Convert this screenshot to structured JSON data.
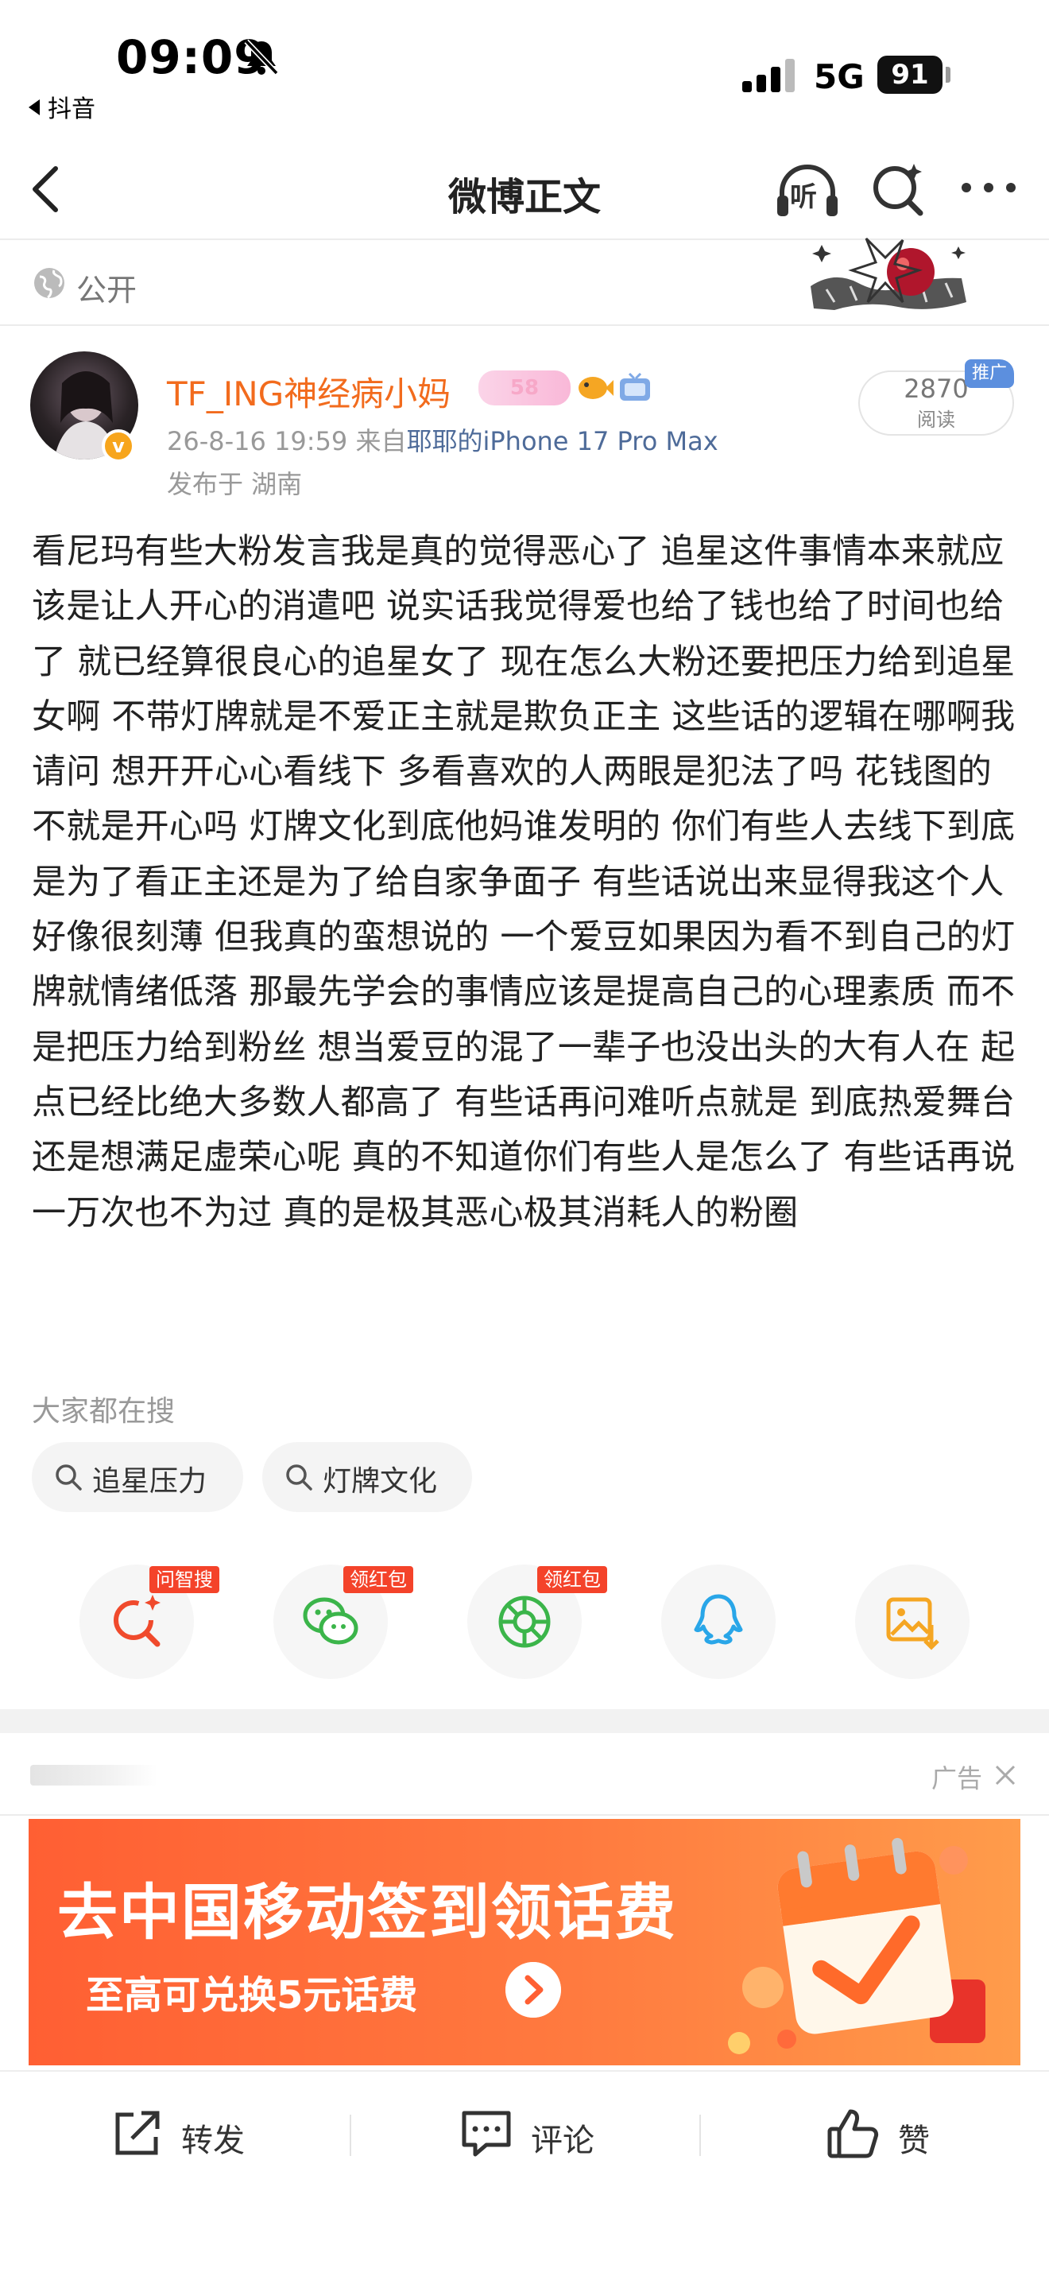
{
  "status_bar": {
    "time": "09:09",
    "back_app": "抖音",
    "network": "5G",
    "battery": "91"
  },
  "nav": {
    "title": "微博正文",
    "listen_label": "听"
  },
  "visibility": {
    "label": "公开"
  },
  "author": {
    "name": "TF_ING神经病小妈",
    "level": "58",
    "verified_mark": "v",
    "time": "26-8-16 19:59",
    "source_prefix": "来自",
    "source": "耶耶的iPhone 17 Pro Max",
    "location": "发布于 湖南"
  },
  "reads": {
    "count": "2870",
    "label": "阅读",
    "promo_tag": "推广"
  },
  "post": {
    "text": "看尼玛有些大粉发言我是真的觉得恶心了 追星这件事情本来就应该是让人开心的消遣吧 说实话我觉得爱也给了钱也给了时间也给了 就已经算很良心的追星女了 现在怎么大粉还要把压力给到追星女啊 不带灯牌就是不爱正主就是欺负正主 这些话的逻辑在哪啊我请问 想开开心心看线下 多看喜欢的人两眼是犯法了吗 花钱图的不就是开心吗 灯牌文化到底他妈谁发明的 你们有些人去线下到底是为了看正主还是为了给自家争面子 有些话说出来显得我这个人好像很刻薄 但我真的蛮想说的 一个爱豆如果因为看不到自己的灯牌就情绪低落 那最先学会的事情应该是提高自己的心理素质 而不是把压力给到粉丝 想当爱豆的混了一辈子也没出头的大有人在 起点已经比绝大多数人都高了 有些话再问难听点就是 到底热爱舞台还是想满足虚荣心呢 真的不知道你们有些人是怎么了 有些话再说一万次也不为过 真的是极其恶心极其消耗人的粉圈"
  },
  "search": {
    "title": "大家都在搜",
    "chips": [
      {
        "label": "追星压力"
      },
      {
        "label": "灯牌文化"
      }
    ]
  },
  "share": {
    "tags": [
      "问智搜",
      "领红包",
      "领红包"
    ],
    "icons": [
      "ai-search-icon",
      "wechat-icon",
      "moments-icon",
      "qq-icon",
      "save-image-icon"
    ]
  },
  "ad": {
    "label": "广告",
    "headline": "去中国移动签到领话费",
    "subline": "至高可兑换5元话费"
  },
  "bottom_bar": {
    "repost": "转发",
    "comment": "评论",
    "like": "赞"
  },
  "colors": {
    "accent_orange": "#f26b1d",
    "link_blue": "#4e6b99",
    "tag_red": "#f4432a",
    "promo_blue": "#5c8fde"
  }
}
